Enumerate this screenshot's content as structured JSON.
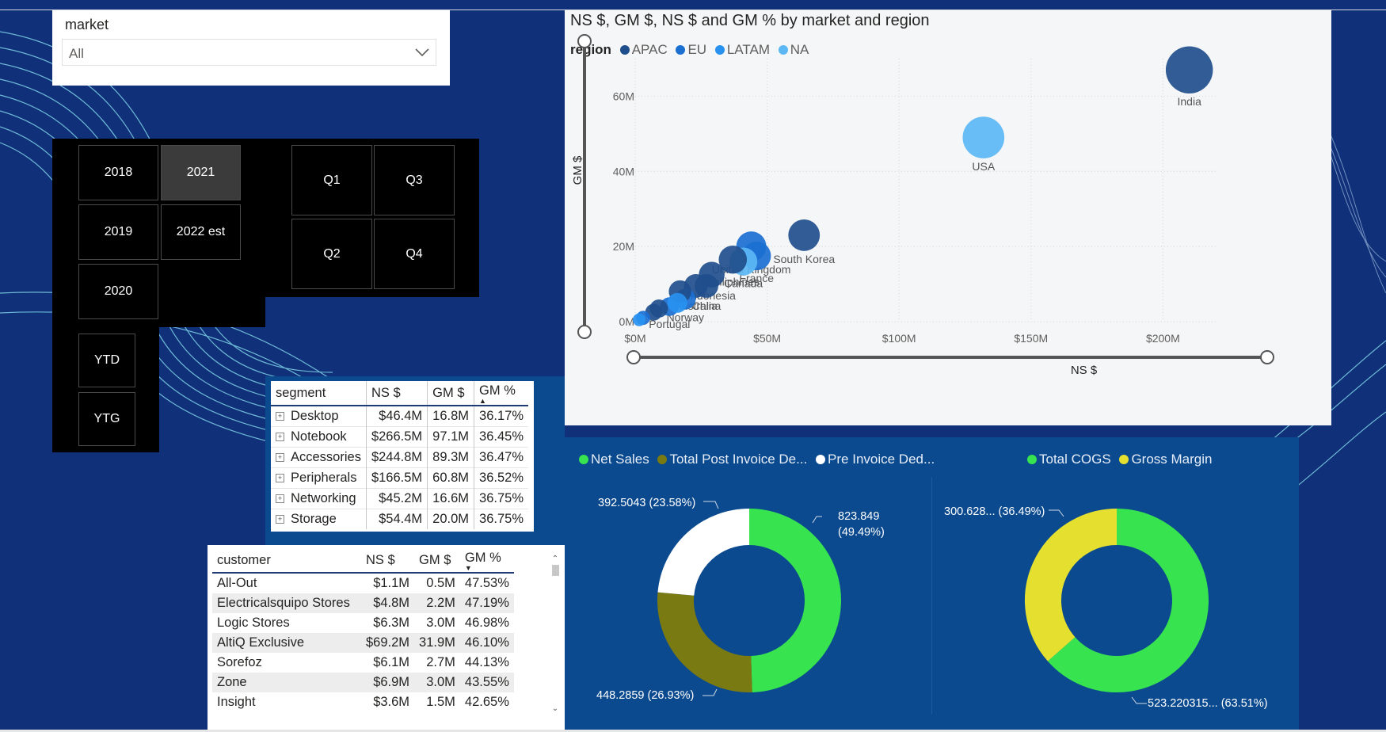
{
  "filters": {
    "market": {
      "title": "market",
      "value": "All"
    }
  },
  "years": {
    "items": [
      "2018",
      "2021",
      "2019",
      "2022 est",
      "2020"
    ],
    "selected": "2021"
  },
  "periods": {
    "items": [
      "YTD",
      "YTG"
    ]
  },
  "quarters": {
    "items": [
      "Q1",
      "Q3",
      "Q2",
      "Q4"
    ]
  },
  "scatter": {
    "title": "NS $, GM $, NS $ and GM % by market and region",
    "legend_title": "region",
    "legend": [
      {
        "name": "APAC",
        "color": "#1f4e8c"
      },
      {
        "name": "EU",
        "color": "#1a6fd1"
      },
      {
        "name": "LATAM",
        "color": "#2891f0"
      },
      {
        "name": "NA",
        "color": "#5cb7f5"
      }
    ]
  },
  "chart_data": [
    {
      "type": "scatter",
      "title": "NS $, GM $, NS $ and GM % by market and region",
      "xlabel": "NS $",
      "ylabel": "GM $",
      "xlim": [
        0,
        220
      ],
      "ylim": [
        0,
        70
      ],
      "x_ticks": [
        "$0M",
        "$50M",
        "$100M",
        "$150M",
        "$200M"
      ],
      "y_ticks": [
        "0M",
        "20M",
        "40M",
        "60M"
      ],
      "grid": true,
      "legend_position": "top-left",
      "points": [
        {
          "label": "India",
          "x": 210,
          "y": 67,
          "region": "APAC"
        },
        {
          "label": "USA",
          "x": 132,
          "y": 49,
          "region": "NA"
        },
        {
          "label": "South Korea",
          "x": 64,
          "y": 23,
          "region": "APAC"
        },
        {
          "label": "United Kingdom",
          "x": 44,
          "y": 20,
          "region": "EU"
        },
        {
          "label": "France",
          "x": 46,
          "y": 17.5,
          "region": "EU"
        },
        {
          "label": "Canada",
          "x": 41,
          "y": 16,
          "region": "NA"
        },
        {
          "label": "Philiphines",
          "x": 37,
          "y": 16.5,
          "region": "APAC"
        },
        {
          "label": "Indonesia",
          "x": 29,
          "y": 12.5,
          "region": "APAC"
        },
        {
          "label": "China",
          "x": 27,
          "y": 9.5,
          "region": "APAC"
        },
        {
          "label": "Australia",
          "x": 23,
          "y": 9.5,
          "region": "APAC"
        },
        {
          "label": "Norway",
          "x": 19,
          "y": 6,
          "region": "EU"
        },
        {
          "label": "Portugal",
          "x": 13,
          "y": 4,
          "region": "EU"
        },
        {
          "label": "",
          "x": 17,
          "y": 8,
          "region": "APAC"
        },
        {
          "label": "",
          "x": 16,
          "y": 5,
          "region": "LATAM"
        },
        {
          "label": "",
          "x": 9,
          "y": 3.5,
          "region": "APAC"
        },
        {
          "label": "",
          "x": 7,
          "y": 2.5,
          "region": "APAC"
        },
        {
          "label": "",
          "x": 3,
          "y": 1,
          "region": "EU"
        },
        {
          "label": "",
          "x": 1.5,
          "y": 0.5,
          "region": "LATAM"
        }
      ]
    },
    {
      "type": "pie",
      "title": "",
      "labels": [
        "Net Sales",
        "Total Post Invoice De...",
        "Pre Invoice Ded..."
      ],
      "values": [
        823.849,
        448.2859,
        392.5043
      ],
      "data_labels": [
        "823.849\n(49.49%)",
        "448.2859 (26.93%)",
        "392.5043 (23.58%)"
      ],
      "colors": [
        "#37e34f",
        "#7a7a12",
        "#ffffff"
      ]
    },
    {
      "type": "pie",
      "title": "",
      "labels": [
        "Total COGS",
        "Gross Margin"
      ],
      "values": [
        523.220315,
        300.628
      ],
      "data_labels": [
        "523.220315... (63.51%)",
        "300.628... (36.49%)"
      ],
      "colors": [
        "#37e34f",
        "#e5e030"
      ]
    }
  ],
  "segment_table": {
    "columns": [
      "segment",
      "NS $",
      "GM $",
      "GM %"
    ],
    "rows": [
      [
        "Desktop",
        "$46.4M",
        "16.8M",
        "36.17%"
      ],
      [
        "Notebook",
        "$266.5M",
        "97.1M",
        "36.45%"
      ],
      [
        "Accessories",
        "$244.8M",
        "89.3M",
        "36.47%"
      ],
      [
        "Peripherals",
        "$166.5M",
        "60.8M",
        "36.52%"
      ],
      [
        "Networking",
        "$45.2M",
        "16.6M",
        "36.75%"
      ],
      [
        "Storage",
        "$54.4M",
        "20.0M",
        "36.75%"
      ]
    ]
  },
  "customer_table": {
    "columns": [
      "customer",
      "NS $",
      "GM $",
      "GM %"
    ],
    "rows": [
      [
        "All-Out",
        "$1.1M",
        "0.5M",
        "47.53%"
      ],
      [
        "Electricalsquipo Stores",
        "$4.8M",
        "2.2M",
        "47.19%"
      ],
      [
        "Logic Stores",
        "$6.3M",
        "3.0M",
        "46.98%"
      ],
      [
        "AltiQ Exclusive",
        "$69.2M",
        "31.9M",
        "46.10%"
      ],
      [
        "Sorefoz",
        "$6.1M",
        "2.7M",
        "44.13%"
      ],
      [
        "Zone",
        "$6.9M",
        "3.0M",
        "43.55%"
      ],
      [
        "Insight",
        "$3.6M",
        "1.5M",
        "42.65%"
      ]
    ]
  },
  "donut1": {
    "legend": [
      {
        "name": "Net Sales",
        "color": "#37e34f"
      },
      {
        "name": "Total Post Invoice De...",
        "color": "#7a7a12"
      },
      {
        "name": "Pre Invoice Ded...",
        "color": "#ffffff"
      }
    ],
    "label_net_sales_1": "823.849",
    "label_net_sales_2": "(49.49%)",
    "label_post": "448.2859 (26.93%)",
    "label_pre": "392.5043 (23.58%)"
  },
  "donut2": {
    "legend": [
      {
        "name": "Total COGS",
        "color": "#37e34f"
      },
      {
        "name": "Gross Margin",
        "color": "#e5e030"
      }
    ],
    "label_cogs": "523.220315... (63.51%)",
    "label_gm": "300.628... (36.49%)"
  }
}
